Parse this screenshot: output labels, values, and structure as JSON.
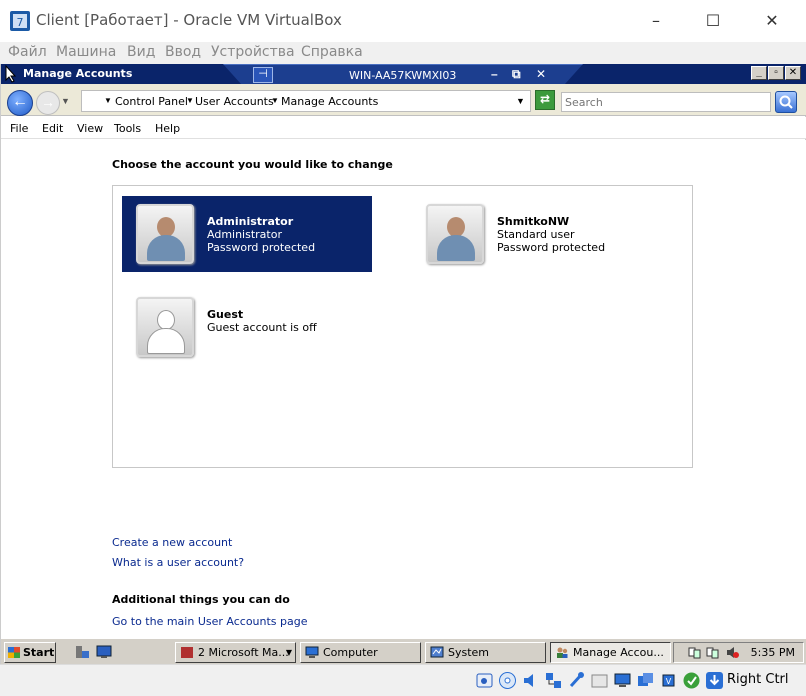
{
  "host": {
    "title": "Client [Работает] - Oracle VM VirtualBox",
    "window_controls": {
      "minimize": "–",
      "maximize": "☐",
      "close": "✕"
    },
    "menu": [
      "Файл",
      "Машина",
      "Вид",
      "Ввод",
      "Устройства",
      "Справка"
    ],
    "status_bar": {
      "host_key_label": "Right Ctrl"
    }
  },
  "guest_window": {
    "title": "Manage Accounts",
    "rdp": {
      "pin": "⊣",
      "hostname": "WIN-AA57KWMXI03",
      "minimize": "–",
      "restore": "⧉",
      "close": "✕"
    },
    "window_controls": {
      "minimize": "_",
      "restore": "▫",
      "close": "✕"
    },
    "breadcrumb": [
      "Control Panel",
      "User Accounts",
      "Manage Accounts"
    ],
    "search_placeholder": "Search",
    "menu": [
      "File",
      "Edit",
      "View",
      "Tools",
      "Help"
    ]
  },
  "main": {
    "heading": "Choose the account you would like to change",
    "accounts": [
      {
        "name": "Administrator",
        "type": "Administrator",
        "status": "Password protected",
        "selected": true
      },
      {
        "name": "ShmitkoNW",
        "type": "Standard user",
        "status": "Password protected",
        "selected": false
      },
      {
        "name": "Guest",
        "type": "Guest account is off",
        "status": "",
        "selected": false
      }
    ],
    "links": {
      "create_account": "Create a new account",
      "what_is_account": "What is a user account?"
    },
    "additional_heading": "Additional things you can do",
    "additional_links": [
      "Go to the main User Accounts page"
    ]
  },
  "taskbar": {
    "start_label": "Start",
    "tasks": [
      {
        "label": "2 Microsoft Ma...",
        "active": false
      },
      {
        "label": "Computer",
        "active": false
      },
      {
        "label": "System",
        "active": false
      },
      {
        "label": "Manage Accou...",
        "active": true
      }
    ],
    "clock": "5:35 PM"
  },
  "colors": {
    "selection": "#0a246a",
    "link": "#0a2a8f",
    "titlebar": "#0a246a"
  }
}
